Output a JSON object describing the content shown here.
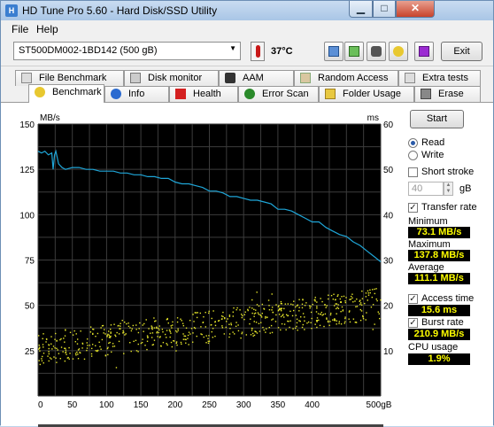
{
  "window": {
    "title": "HD Tune Pro 5.60 - Hard Disk/SSD Utility",
    "icon": "app-icon"
  },
  "menu": [
    "File",
    "Help"
  ],
  "toolbar": {
    "drive": "ST500DM002-1BD142 (500 gB)",
    "temperature": "37°C",
    "exit_label": "Exit",
    "icons": [
      "copy-icon",
      "save-icon",
      "camera-icon",
      "options-icon",
      "download-icon"
    ]
  },
  "tabs": {
    "row1": [
      "File Benchmark",
      "Disk monitor",
      "AAM",
      "Random Access",
      "Extra tests"
    ],
    "row2": [
      "Benchmark",
      "Info",
      "Health",
      "Error Scan",
      "Folder Usage",
      "Erase"
    ],
    "active": "Benchmark"
  },
  "side": {
    "start_label": "Start",
    "read_label": "Read",
    "write_label": "Write",
    "mode": "Read",
    "short_stroke_label": "Short stroke",
    "short_stroke_checked": false,
    "short_stroke_value": "40",
    "short_stroke_unit": "gB",
    "transfer_rate_label": "Transfer rate",
    "transfer_rate_checked": true,
    "minimum_label": "Minimum",
    "minimum_value": "73.1 MB/s",
    "maximum_label": "Maximum",
    "maximum_value": "137.8 MB/s",
    "average_label": "Average",
    "average_value": "111.1 MB/s",
    "access_time_label": "Access time",
    "access_time_checked": true,
    "access_time_value": "15.6 ms",
    "burst_rate_label": "Burst rate",
    "burst_rate_checked": true,
    "burst_rate_value": "210.9 MB/s",
    "cpu_usage_label": "CPU usage",
    "cpu_usage_value": "1.9%"
  },
  "chart_data": {
    "type": "line",
    "y_left_label": "MB/s",
    "y_right_label": "ms",
    "x_unit": "gB",
    "x_ticks": [
      0,
      50,
      100,
      150,
      200,
      250,
      300,
      350,
      400,
      500
    ],
    "x_tick_labels": [
      "0",
      "50",
      "100",
      "150",
      "200",
      "250",
      "300",
      "350",
      "400",
      "500gB"
    ],
    "y_left_ticks": [
      25,
      50,
      75,
      100,
      125,
      150
    ],
    "y_right_ticks": [
      10,
      20,
      30,
      40,
      50,
      60
    ],
    "xlim": [
      0,
      500
    ],
    "y_left_lim": [
      0,
      150
    ],
    "y_right_lim": [
      0,
      60
    ],
    "grid": true,
    "colors": {
      "transfer": "#1fa6d8",
      "access": "#e6e62a",
      "background": "#000000",
      "grid": "#3c3c3c"
    },
    "series": [
      {
        "name": "Transfer rate",
        "axis": "left",
        "x": [
          0,
          5,
          10,
          15,
          20,
          22,
          24,
          26,
          30,
          35,
          40,
          50,
          60,
          70,
          80,
          90,
          100,
          110,
          120,
          130,
          140,
          150,
          160,
          170,
          180,
          190,
          200,
          210,
          220,
          230,
          240,
          250,
          260,
          270,
          280,
          290,
          300,
          310,
          320,
          330,
          340,
          350,
          360,
          370,
          380,
          390,
          400,
          410,
          420,
          430,
          440,
          450,
          460,
          470,
          480,
          490,
          500
        ],
        "values": [
          135,
          134,
          135,
          133,
          134,
          125,
          133,
          135,
          128,
          126,
          125,
          126,
          126,
          125,
          125,
          124,
          124,
          124,
          123,
          123,
          122,
          122,
          121,
          121,
          120,
          120,
          118,
          117,
          117,
          116,
          115,
          113,
          113,
          112,
          110,
          110,
          109,
          108,
          108,
          107,
          106,
          103,
          103,
          102,
          100,
          98,
          96,
          96,
          93,
          91,
          89,
          88,
          85,
          83,
          80,
          77,
          74
        ]
      },
      {
        "name": "Access time",
        "axis": "right",
        "type": "scatter",
        "x_range": [
          0,
          500
        ],
        "approx_values": [
          7,
          24
        ]
      }
    ]
  }
}
